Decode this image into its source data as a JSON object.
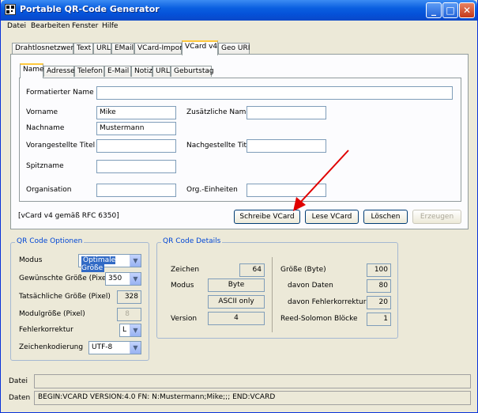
{
  "window": {
    "title": "Portable QR-Code Generator",
    "menus": [
      "Datei",
      "Bearbeiten",
      "Fenster",
      "Hilfe"
    ]
  },
  "outer_tabs": [
    "Drahtlosnetzwerk",
    "Text",
    "URL",
    "EMail",
    "VCard-Import",
    "VCard v4",
    "Geo URI"
  ],
  "outer_selected": "VCard v4",
  "inner_tabs": [
    "Name",
    "Adresse",
    "Telefon",
    "E-Mail",
    "Notiz",
    "URL",
    "Geburtstag"
  ],
  "inner_selected": "Name",
  "name_form": {
    "formatted_name_label": "Formatierter Name",
    "formatted_name_value": "",
    "firstname_label": "Vorname",
    "firstname_value": "Mike",
    "additional_names_label": "Zusätzliche Namen",
    "additional_names_value": "",
    "lastname_label": "Nachname",
    "lastname_value": "Mustermann",
    "prefix_label": "Vorangestellte Titel",
    "prefix_value": "",
    "suffix_label": "Nachgestellte Titel",
    "suffix_value": "",
    "nickname_label": "Spitzname",
    "nickname_value": "",
    "organisation_label": "Organisation",
    "organisation_value": "",
    "org_units_label": "Org.-Einheiten",
    "org_units_value": ""
  },
  "vcard_note": "[vCard v4 gemäß RFC 6350]",
  "actions": {
    "write": "Schreibe VCard",
    "read": "Lese VCard",
    "delete": "Löschen",
    "generate": "Erzeugen"
  },
  "qr_options": {
    "title": "QR Code Optionen",
    "mode_label": "Modus",
    "mode_value": "Optimale Größe",
    "desired_size_label": "Gewünschte Größe (Pixel)",
    "desired_size_value": "350",
    "actual_size_label": "Tatsächliche Größe (Pixel)",
    "actual_size_value": "328",
    "module_size_label": "Modulgröße (Pixel)",
    "module_size_value": "8",
    "error_correction_label": "Fehlerkorrektur",
    "error_correction_value": "L",
    "encoding_label": "Zeichenkodierung",
    "encoding_value": "UTF-8"
  },
  "qr_details": {
    "title": "QR Code Details",
    "chars_label": "Zeichen",
    "chars_value": "64",
    "mode_label": "Modus",
    "mode_value": "Byte",
    "ascii_value": "ASCII only",
    "version_label": "Version",
    "version_value": "4",
    "size_bytes_label": "Größe (Byte)",
    "size_bytes_value": "100",
    "data_label": "davon Daten",
    "data_value": "80",
    "ecc_label": "davon Fehlerkorrektur",
    "ecc_value": "20",
    "rs_blocks_label": "Reed-Solomon Blöcke",
    "rs_blocks_value": "1"
  },
  "status": {
    "file_label": "Datei",
    "file_value": "",
    "data_label": "Daten",
    "data_value": "BEGIN:VCARD VERSION:4.0 FN: N:Mustermann;Mike;;; END:VCARD"
  }
}
